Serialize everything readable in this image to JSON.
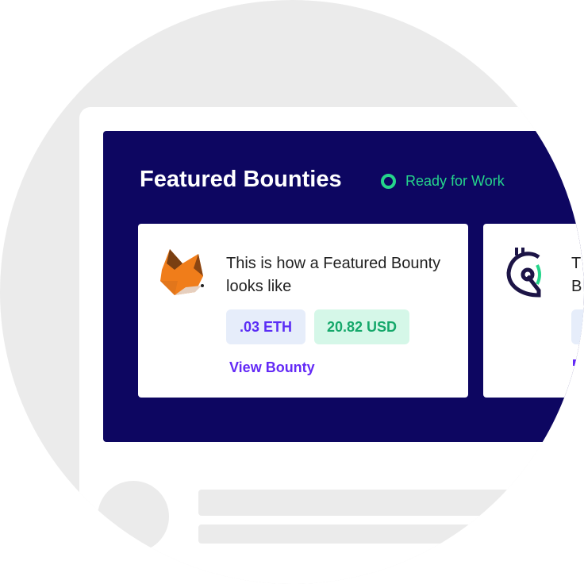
{
  "header": {
    "title": "Featured Bounties",
    "status": "Ready for Work"
  },
  "cards": [
    {
      "title": "This is how a Featured Bounty looks like",
      "eth": ".03 ETH",
      "usd": "20.82 USD",
      "link": "View Bounty",
      "icon": "metamask-fox-icon"
    },
    {
      "title_partial": "T\nB",
      "icon": "gitcoin-logo-icon"
    }
  ],
  "colors": {
    "navy": "#0d0661",
    "green": "#25d58b",
    "purple": "#6329f6",
    "gray": "#ebebeb"
  }
}
